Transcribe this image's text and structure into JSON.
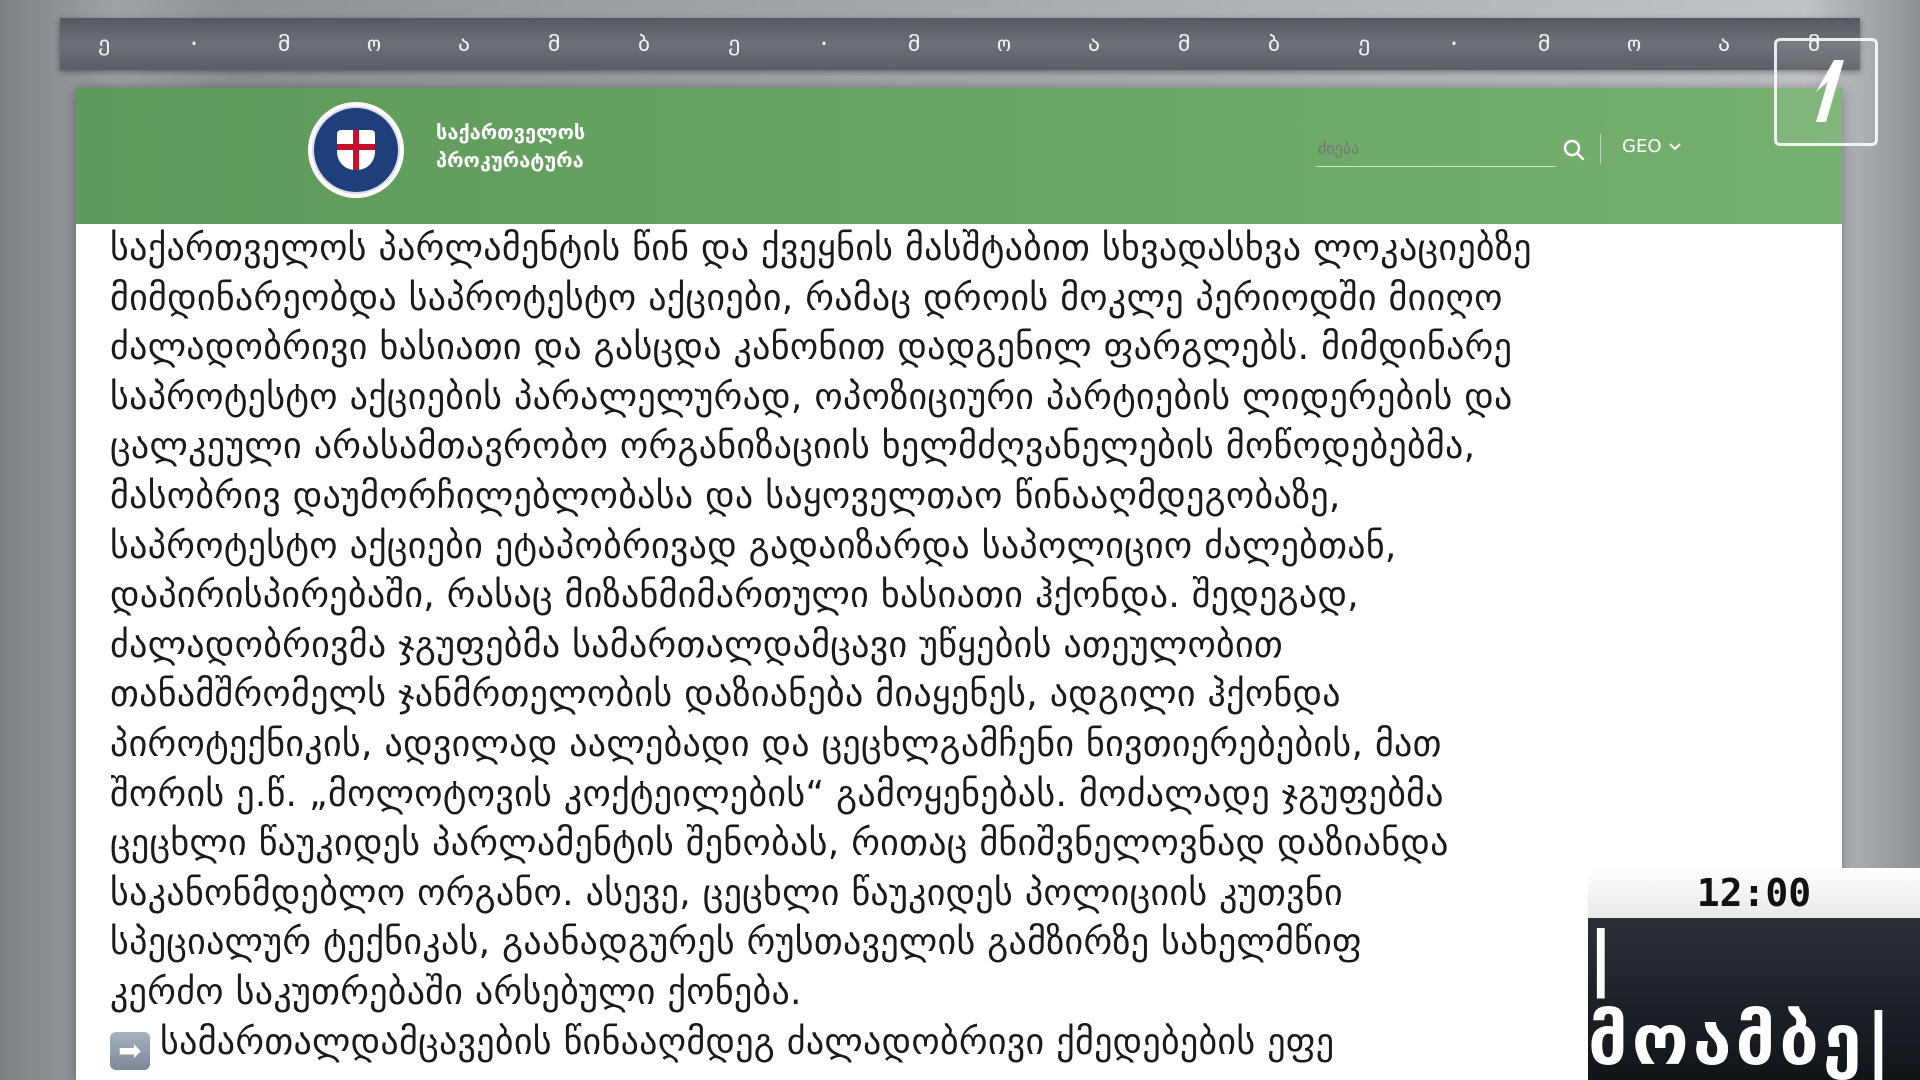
{
  "ticker": [
    "ე",
    "·",
    "მ",
    "ო",
    "ა",
    "მ",
    "ბ",
    "ე",
    "·",
    "მ",
    "ო",
    "ა",
    "მ",
    "ბ",
    "ე",
    "·",
    "მ",
    "ო",
    "ა",
    "მ"
  ],
  "header": {
    "org_line1": "საქართველოს",
    "org_line2": "პროკურატურა",
    "search_placeholder": "ძიება",
    "language": "GEO"
  },
  "article": {
    "lines": [
      "საქართველოს პარლამენტის წინ და ქვეყნის მასშტაბით სხვადასხვა ლოკაციებზე",
      "მიმდინარეობდა საპროტესტო აქციები, რამაც დროის მოკლე პერიოდში მიიღო",
      "ძალადობრივი ხასიათი და გასცდა კანონით დადგენილ ფარგლებს. მიმდინარე",
      "საპროტესტო აქციების პარალელურად, ოპოზიციური პარტიების ლიდერების და",
      "ცალკეული არასამთავრობო ორგანიზაციის ხელმძღვანელების მოწოდებებმა,",
      "მასობრივ დაუმორჩილებლობასა და საყოველთაო წინააღმდეგობაზე,",
      "საპროტესტო აქციები ეტაპობრივად გადაიზარდა საპოლიციო ძალებთან,",
      "დაპირისპირებაში, რასაც მიზანმიმართული ხასიათი ჰქონდა. შედეგად,",
      "ძალადობრივმა ჯგუფებმა სამართალდამცავი უწყების ათეულობით",
      "თანამშრომელს ჯანმრთელობის დაზიანება მიაყენეს, ადგილი ჰქონდა",
      "პიროტექნიკის, ადვილად აალებადი და ცეცხლგამჩენი ნივთიერებების, მათ",
      "შორის ე.წ. „მოლოტოვის კოქტეილების“ გამოყენებას. მოძალადე ჯგუფებმა",
      "ცეცხლი წაუკიდეს პარლამენტის შენობას, რითაც მნიშვნელოვნად დაზიანდა",
      "საკანონმდებლო ორგანო. ასევე, ცეცხლი წაუკიდეს პოლიციის კუთვნი",
      "სპეციალურ ტექნიკას, გაანადგურეს რუსთაველის გამზირზე სახელმწიფ",
      "კერძო საკუთრებაში არსებული ქონება."
    ],
    "bullet_line": "სამართალდამცავების წინააღმდეგ ძალადობრივი ქმედებების ეფე"
  },
  "overlay": {
    "time": "12:00",
    "program": "|მოამბე|"
  }
}
